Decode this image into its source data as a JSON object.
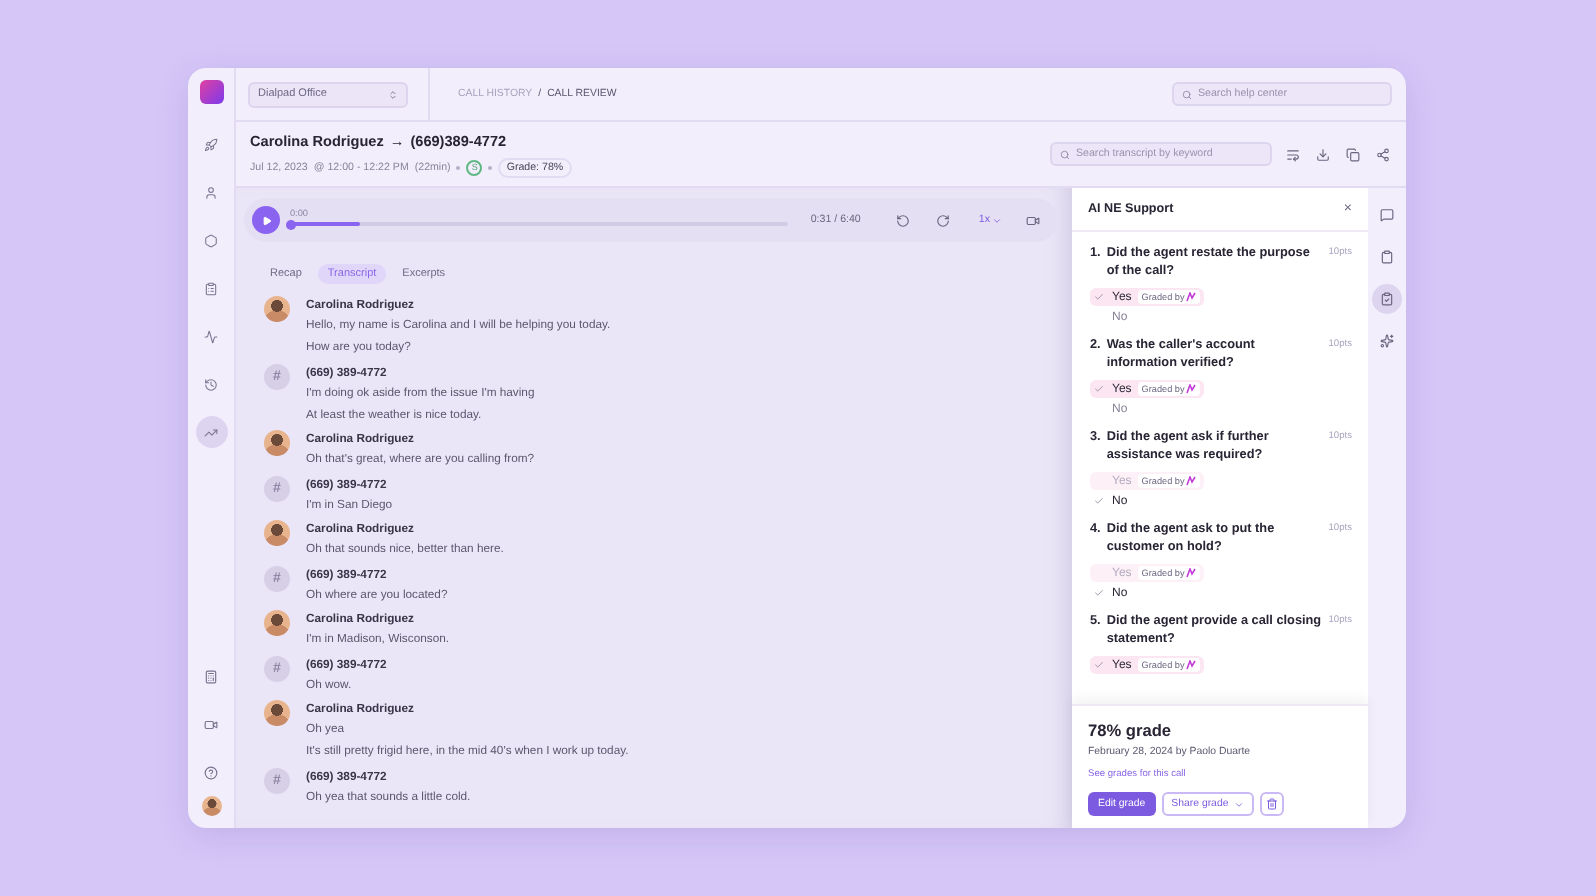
{
  "workspace": {
    "name": "Dialpad Office"
  },
  "breadcrumb": [
    "CALL HISTORY",
    "CALL REVIEW"
  ],
  "breadcrumb_separator": "/",
  "help_search": {
    "placeholder": "Search help center"
  },
  "nav": [
    {
      "selected": false
    },
    {
      "selected": false
    },
    {
      "selected": false
    },
    {
      "selected": false
    },
    {
      "selected": false
    },
    {
      "selected": false
    },
    {
      "selected": true
    }
  ],
  "call": {
    "agent": "Carolina Rodriguez",
    "arrow": "→",
    "number": "(669)389-4772",
    "date": "Jul 12, 2023",
    "time": "@ 12:00 - 12:22 PM",
    "duration": "(22min)",
    "sentiment": "S",
    "grade": "Grade: 78%"
  },
  "transcript_search": {
    "placeholder": "Search transcript by keyword"
  },
  "player": {
    "start": "0:00",
    "position": "0:31 / 6:40",
    "speed": "1x",
    "level": 0.14
  },
  "tabs": [
    {
      "label": "Recap",
      "selected": false
    },
    {
      "label": "Transcript",
      "selected": true
    },
    {
      "label": "Excerpts",
      "selected": false
    }
  ],
  "messages": [
    {
      "kind": "agent",
      "speaker": "Carolina Rodriguez",
      "lines": [
        "Hello, my name is Carolina and I will be helping you today.",
        "How are you today?"
      ]
    },
    {
      "kind": "caller",
      "speaker": "(669) 389-4772",
      "avatar": "#",
      "lines": [
        "I'm doing ok aside from the issue I'm having",
        "At least the weather is nice today."
      ]
    },
    {
      "kind": "agent",
      "speaker": "Carolina Rodriguez",
      "lines": [
        "Oh that's great, where are you calling from?"
      ]
    },
    {
      "kind": "caller",
      "speaker": "(669) 389-4772",
      "avatar": "#",
      "lines": [
        "I'm in San Diego"
      ]
    },
    {
      "kind": "agent",
      "speaker": "Carolina Rodriguez",
      "lines": [
        "Oh that sounds nice, better than here."
      ]
    },
    {
      "kind": "caller",
      "speaker": "(669) 389-4772",
      "avatar": "#",
      "lines": [
        "Oh where are you located?"
      ]
    },
    {
      "kind": "agent",
      "speaker": "Carolina Rodriguez",
      "lines": [
        "I'm in Madison, Wisconson."
      ]
    },
    {
      "kind": "caller",
      "speaker": "(669) 389-4772",
      "avatar": "#",
      "lines": [
        "Oh wow."
      ]
    },
    {
      "kind": "agent",
      "speaker": "Carolina Rodriguez",
      "lines": [
        "Oh yea",
        "It's still pretty frigid here, in the mid 40's when I work up today."
      ]
    },
    {
      "kind": "caller",
      "speaker": "(669) 389-4772",
      "avatar": "#",
      "lines": [
        "Oh yea that sounds a little cold."
      ]
    }
  ],
  "panel": {
    "title": "AI NE Support",
    "close": "×",
    "questions": [
      {
        "number": "1.",
        "text": "Did the agent restate the purpose of the call?",
        "points": "10pts",
        "options": [
          {
            "label": "Yes",
            "selected": true,
            "badge": "Graded by"
          },
          {
            "label": "No",
            "selected": false
          }
        ]
      },
      {
        "number": "2.",
        "text": "Was the caller's account information verified?",
        "points": "10pts",
        "options": [
          {
            "label": "Yes",
            "selected": true,
            "badge": "Graded by"
          },
          {
            "label": "No",
            "selected": false
          }
        ]
      },
      {
        "number": "3.",
        "text": "Did the agent ask if further assistance was required?",
        "points": "10pts",
        "options": [
          {
            "label": "Yes",
            "selected": false,
            "badge": "Graded by"
          },
          {
            "label": "No",
            "selected": true
          }
        ]
      },
      {
        "number": "4.",
        "text": "Did the agent ask to put the customer on hold?",
        "points": "10pts",
        "options": [
          {
            "label": "Yes",
            "selected": false,
            "badge": "Graded by"
          },
          {
            "label": "No",
            "selected": true
          }
        ]
      },
      {
        "number": "5.",
        "text": "Did the agent provide a call closing statement?",
        "points": "10pts",
        "options": [
          {
            "label": "Yes",
            "selected": true,
            "badge": "Graded by"
          }
        ]
      }
    ]
  },
  "summary": {
    "grade": "78% grade",
    "meta": "February 28, 2024 by Paolo Duarte",
    "link": "See grades for this call",
    "edit": "Edit grade",
    "share": "Share grade"
  },
  "right_rail": [
    {
      "selected": false
    },
    {
      "selected": false
    },
    {
      "selected": true
    },
    {
      "selected": false
    }
  ]
}
